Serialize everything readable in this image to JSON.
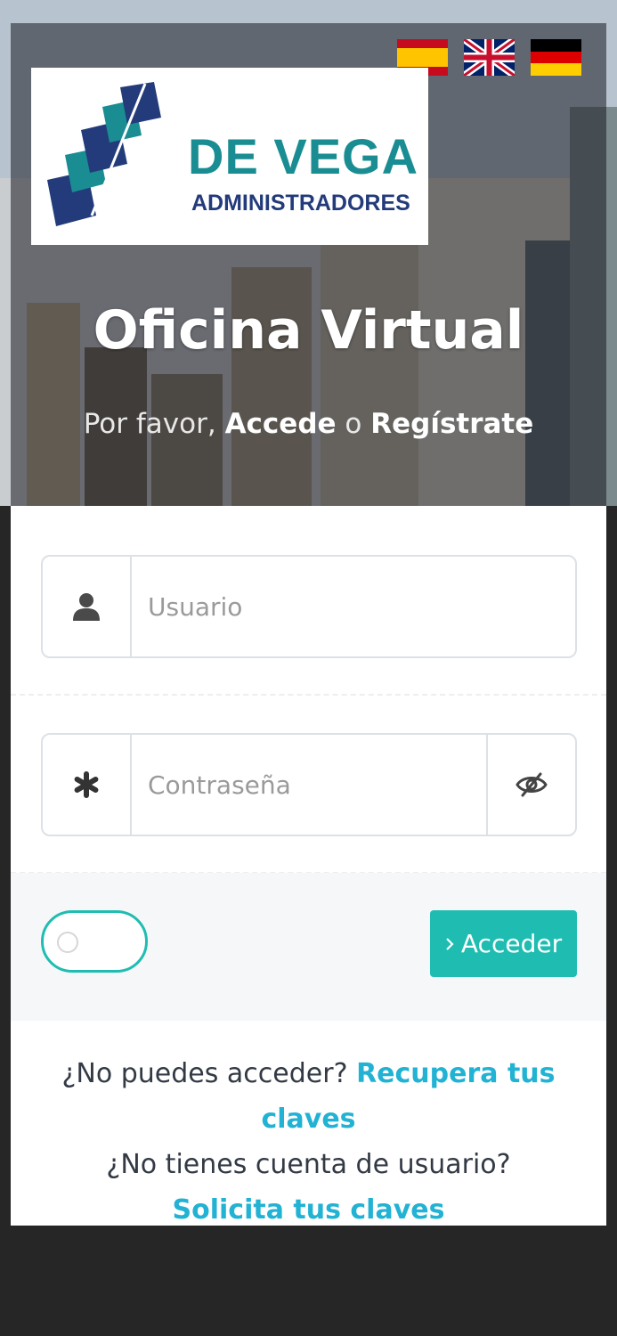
{
  "languages": [
    {
      "name": "Español",
      "flag": "es-flag-icon"
    },
    {
      "name": "English",
      "flag": "uk-flag-icon"
    },
    {
      "name": "Deutsch",
      "flag": "de-flag-icon"
    }
  ],
  "logo": {
    "title": "DE VEGA",
    "subtitle": "ADMINISTRADORES"
  },
  "hero": {
    "title": "Oficina Virtual",
    "subtitle_prefix": "Por favor,",
    "login_link": "Accede",
    "connector": "o",
    "register_link": "Regístrate"
  },
  "form": {
    "username_placeholder": "Usuario",
    "password_placeholder": "Contraseña",
    "remember_toggle_on": false,
    "submit_label": "Acceder"
  },
  "footer": {
    "recover_question": "¿No puedes acceder?",
    "recover_link": "Recupera tus claves",
    "request_question": "¿No tienes cuenta de usuario?",
    "request_link": "Solicita tus claves"
  },
  "colors": {
    "accent": "#1fbdb1",
    "link": "#22b2d3",
    "logo_teal": "#1a8d93",
    "logo_navy": "#233b7a",
    "page_bg": "#262626"
  }
}
